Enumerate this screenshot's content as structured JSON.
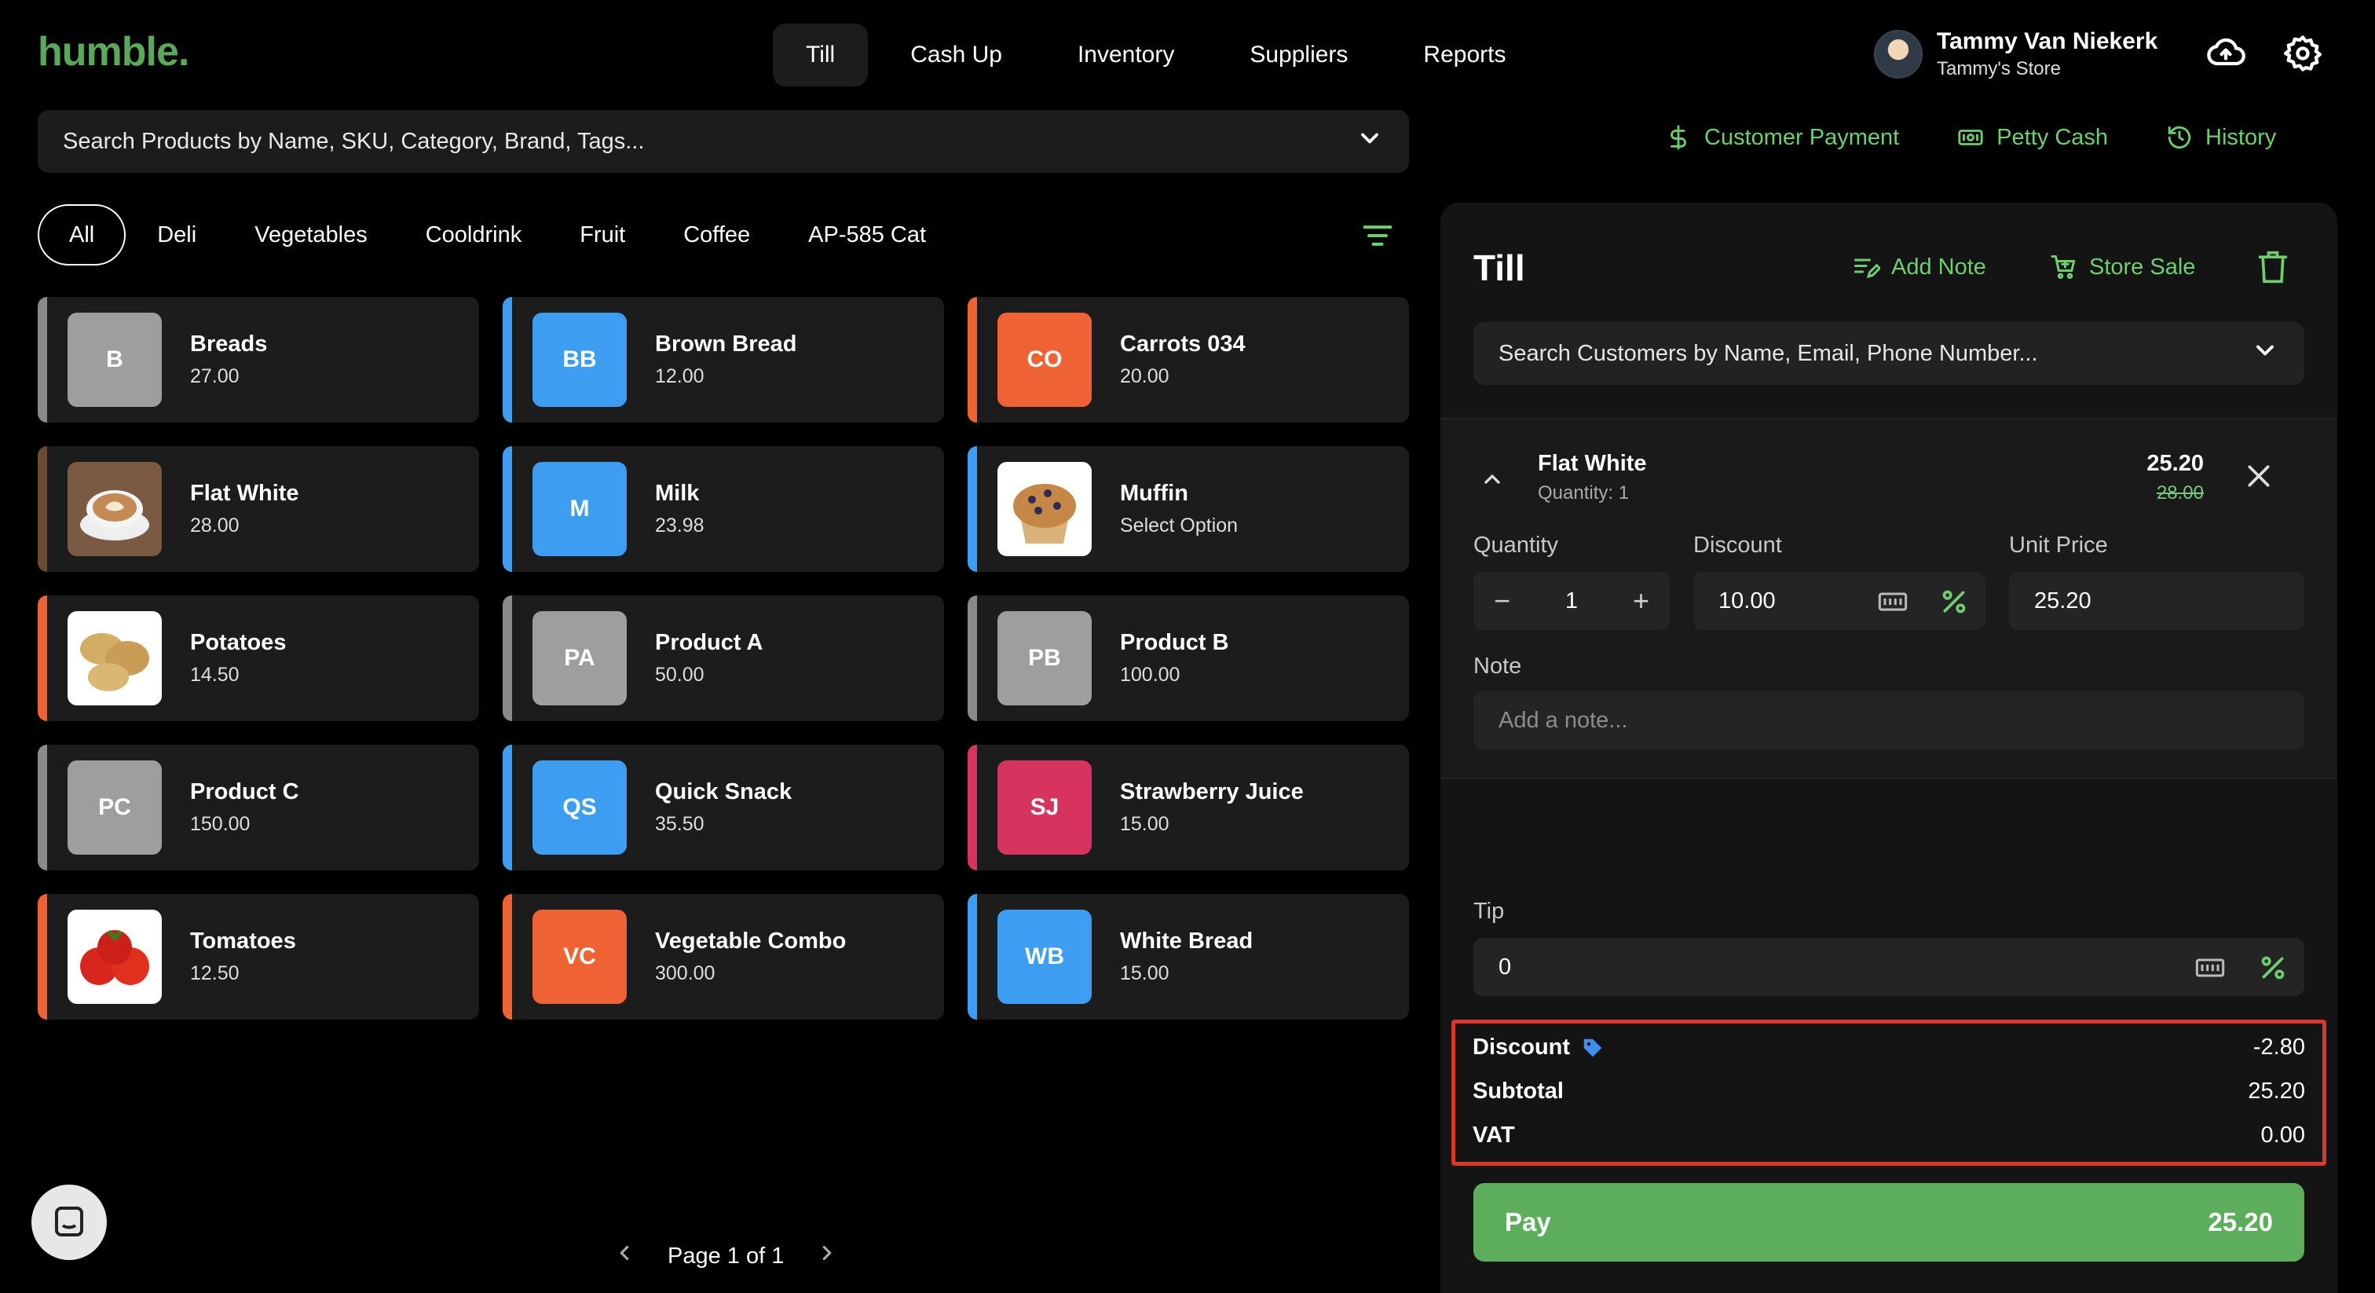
{
  "app": {
    "logo": "humble."
  },
  "nav": {
    "items": [
      {
        "label": "Till",
        "active": true
      },
      {
        "label": "Cash Up",
        "active": false
      },
      {
        "label": "Inventory",
        "active": false
      },
      {
        "label": "Suppliers",
        "active": false
      },
      {
        "label": "Reports",
        "active": false
      }
    ]
  },
  "user": {
    "name": "Tammy Van Niekerk",
    "store": "Tammy's Store"
  },
  "product_search": {
    "placeholder": "Search Products by Name, SKU, Category, Brand, Tags..."
  },
  "categories": [
    "All",
    "Deli",
    "Vegetables",
    "Cooldrink",
    "Fruit",
    "Coffee",
    "AP-585 Cat"
  ],
  "products": [
    {
      "name": "Breads",
      "price": "27.00",
      "initials": "B",
      "color": "#9e9e9e",
      "stripe": "#8a8a8a",
      "image": ""
    },
    {
      "name": "Brown Bread",
      "price": "12.00",
      "initials": "BB",
      "color": "#3d9df0",
      "stripe": "#3d9df0",
      "image": ""
    },
    {
      "name": "Carrots 034",
      "price": "20.00",
      "initials": "CO",
      "color": "#ef6233",
      "stripe": "#ef6233",
      "image": ""
    },
    {
      "name": "Flat White",
      "price": "28.00",
      "initials": "",
      "color": "#6b4a33",
      "stripe": "#6b4a33",
      "image": "coffee"
    },
    {
      "name": "Milk",
      "price": "23.98",
      "initials": "M",
      "color": "#3d9df0",
      "stripe": "#3d9df0",
      "image": ""
    },
    {
      "name": "Muffin",
      "price": "Select Option",
      "initials": "",
      "color": "#3d9df0",
      "stripe": "#3d9df0",
      "image": "muffin"
    },
    {
      "name": "Potatoes",
      "price": "14.50",
      "initials": "",
      "color": "#ef6233",
      "stripe": "#ef6233",
      "image": "potatoes"
    },
    {
      "name": "Product A",
      "price": "50.00",
      "initials": "PA",
      "color": "#9e9e9e",
      "stripe": "#8a8a8a",
      "image": ""
    },
    {
      "name": "Product B",
      "price": "100.00",
      "initials": "PB",
      "color": "#9e9e9e",
      "stripe": "#8a8a8a",
      "image": ""
    },
    {
      "name": "Product C",
      "price": "150.00",
      "initials": "PC",
      "color": "#9e9e9e",
      "stripe": "#8a8a8a",
      "image": ""
    },
    {
      "name": "Quick Snack",
      "price": "35.50",
      "initials": "QS",
      "color": "#3d9df0",
      "stripe": "#3d9df0",
      "image": ""
    },
    {
      "name": "Strawberry Juice",
      "price": "15.00",
      "initials": "SJ",
      "color": "#d6335f",
      "stripe": "#d6335f",
      "image": ""
    },
    {
      "name": "Tomatoes",
      "price": "12.50",
      "initials": "",
      "color": "#ef6233",
      "stripe": "#ef6233",
      "image": "tomatoes"
    },
    {
      "name": "Vegetable Combo",
      "price": "300.00",
      "initials": "VC",
      "color": "#ef6233",
      "stripe": "#ef6233",
      "image": ""
    },
    {
      "name": "White Bread",
      "price": "15.00",
      "initials": "WB",
      "color": "#3d9df0",
      "stripe": "#3d9df0",
      "image": ""
    }
  ],
  "pagination": {
    "label": "Page 1 of 1"
  },
  "right_actions": {
    "customer_payment": "Customer Payment",
    "petty_cash": "Petty Cash",
    "history": "History"
  },
  "till": {
    "title": "Till",
    "add_note": "Add Note",
    "store_sale": "Store Sale",
    "customer_search_placeholder": "Search Customers by Name, Email, Phone Number...",
    "line_item": {
      "name": "Flat White",
      "quantity_text": "Quantity: 1",
      "price": "25.20",
      "original_price": "28.00",
      "quantity_label": "Quantity",
      "quantity_value": "1",
      "discount_label": "Discount",
      "discount_value": "10.00",
      "unit_price_label": "Unit Price",
      "unit_price_value": "25.20",
      "note_label": "Note",
      "note_placeholder": "Add a note..."
    },
    "tip_label": "Tip",
    "tip_value": "0",
    "summary": {
      "discount_label": "Discount",
      "discount_value": "-2.80",
      "subtotal_label": "Subtotal",
      "subtotal_value": "25.20",
      "vat_label": "VAT",
      "vat_value": "0.00"
    },
    "pay_label": "Pay",
    "pay_amount": "25.20"
  },
  "colors": {
    "accent": "#6fcf6f",
    "pay": "#5cae5c",
    "highlight": "#d9382a"
  }
}
